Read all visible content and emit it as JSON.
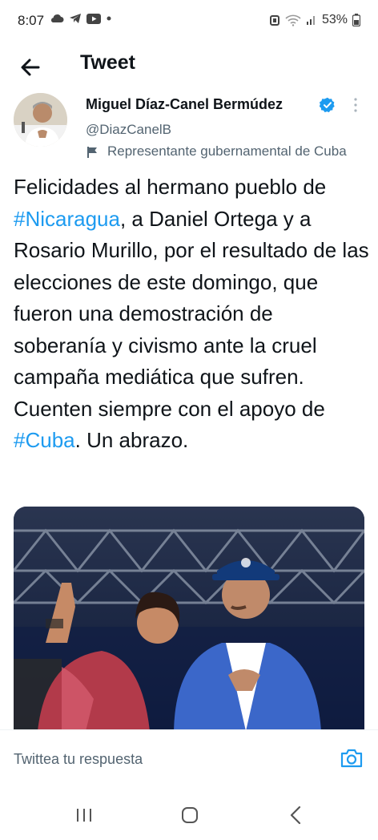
{
  "status_bar": {
    "time": "8:07",
    "left_icons": [
      "cloud-icon",
      "telegram-icon",
      "youtube-icon",
      "dot-icon"
    ],
    "right_icons": [
      "alarm-icon",
      "wifi-icon",
      "signal-icon",
      "battery-icon"
    ],
    "battery_percent": "53%"
  },
  "header": {
    "title": "Tweet"
  },
  "tweet": {
    "author_name": "Miguel Díaz-Canel Bermúdez",
    "author_handle": "@DiazCanelB",
    "gov_label": "Representante gubernamental de Cuba",
    "text": {
      "p1": "Felicidades al hermano pueblo de ",
      "hashtag1": "#Nicaragua",
      "p2": ", a Daniel Ortega y a Rosario Murillo, por el resultado de las elecciones de este domingo, que fueron una demostración de soberanía y civismo ante la cruel campaña mediática que sufren. Cuenten siempre con el apoyo de ",
      "hashtag2": "#Cuba",
      "p3": ". Un abrazo."
    }
  },
  "reply_bar": {
    "placeholder": "Twittea tu respuesta"
  },
  "colors": {
    "accent": "#1d9bf0",
    "text": "#0f1419",
    "secondary": "#536471"
  }
}
